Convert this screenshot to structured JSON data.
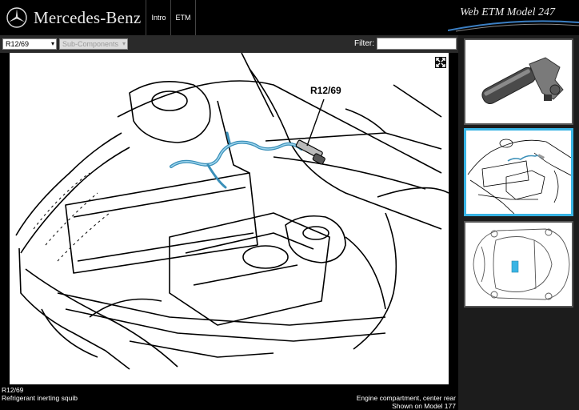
{
  "header": {
    "brand": "Mercedes-Benz",
    "nav": {
      "intro": "Intro",
      "etm": "ETM"
    },
    "app_title": "Web ETM Model 247"
  },
  "toolbar": {
    "component_value": "R12/69",
    "subcomponents_placeholder": "Sub-Components",
    "filter_label": "Filter:",
    "filter_value": ""
  },
  "viewer": {
    "callout_label": "R12/69",
    "harness_color": "#3a8fb8",
    "highlight_color": "#39b4e4"
  },
  "info": {
    "component_code": "R12/69",
    "component_name": "Refrigerant inerting squib",
    "location": "Engine compartment, center rear",
    "model_note": "Shown on Model 177"
  },
  "icons": {
    "logo": "mercedes-star-icon",
    "expand": "expand-icon",
    "dropdown": "chevron-down-icon"
  }
}
